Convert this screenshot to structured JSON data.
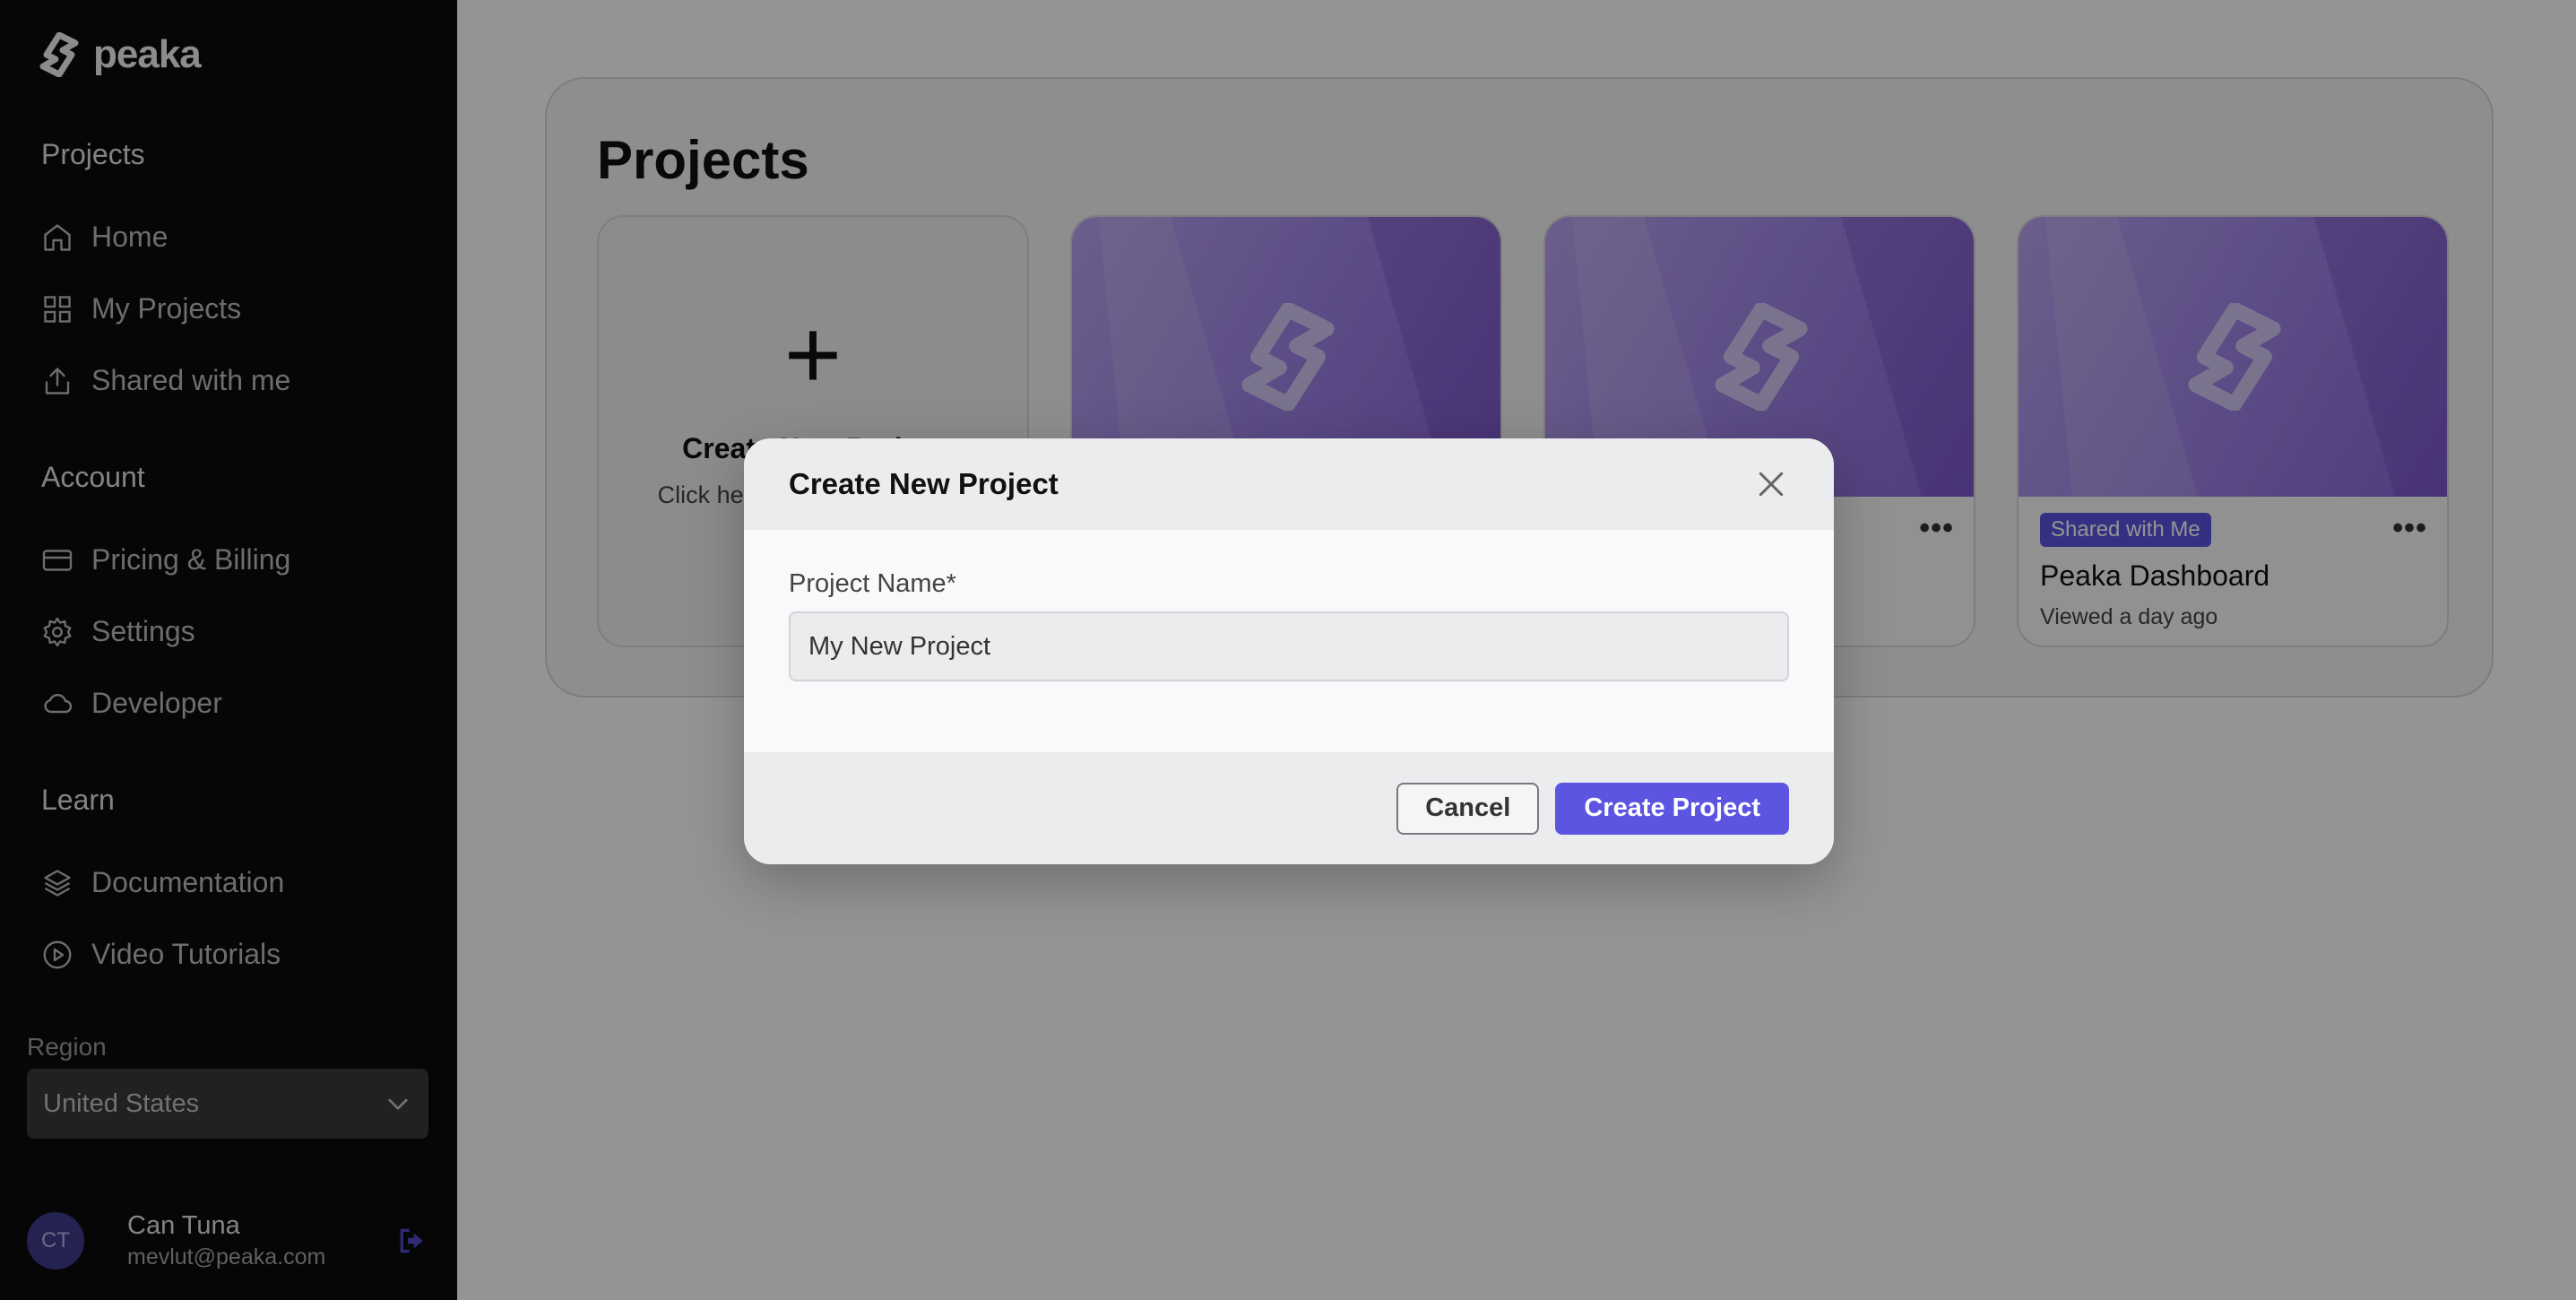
{
  "brand": {
    "name": "peaka"
  },
  "sidebar": {
    "sections": {
      "projects": "Projects",
      "account": "Account",
      "learn": "Learn"
    },
    "items": [
      {
        "label": "Home",
        "icon": "home-icon"
      },
      {
        "label": "My Projects",
        "icon": "grid-icon"
      },
      {
        "label": "Shared with me",
        "icon": "share-icon"
      },
      {
        "label": "Pricing & Billing",
        "icon": "credit-card-icon"
      },
      {
        "label": "Settings",
        "icon": "gear-icon"
      },
      {
        "label": "Developer",
        "icon": "cloud-icon"
      },
      {
        "label": "Documentation",
        "icon": "layers-icon"
      },
      {
        "label": "Video Tutorials",
        "icon": "play-circle-icon"
      }
    ],
    "region": {
      "label": "Region",
      "value": "United States"
    },
    "user": {
      "initials": "CT",
      "name": "Can Tuna",
      "email": "mevlut@peaka.com"
    }
  },
  "main": {
    "title": "Projects",
    "new_card": {
      "title": "Create New Project",
      "description": "Click here to get started from scratch"
    },
    "cards": [
      {
        "badge": "",
        "title": "",
        "subtitle": ""
      },
      {
        "badge": "",
        "title": "",
        "subtitle": ""
      },
      {
        "badge": "Shared with Me",
        "title": "Peaka Dashboard",
        "subtitle": "Viewed a day ago"
      }
    ]
  },
  "modal": {
    "title": "Create New Project",
    "field_label": "Project Name*",
    "field_value": "My New Project",
    "cancel_label": "Cancel",
    "submit_label": "Create Project"
  },
  "colors": {
    "accent": "#5b55e1",
    "sidebar_bg": "#0b0b0c",
    "card_purple": "#a287e8"
  }
}
